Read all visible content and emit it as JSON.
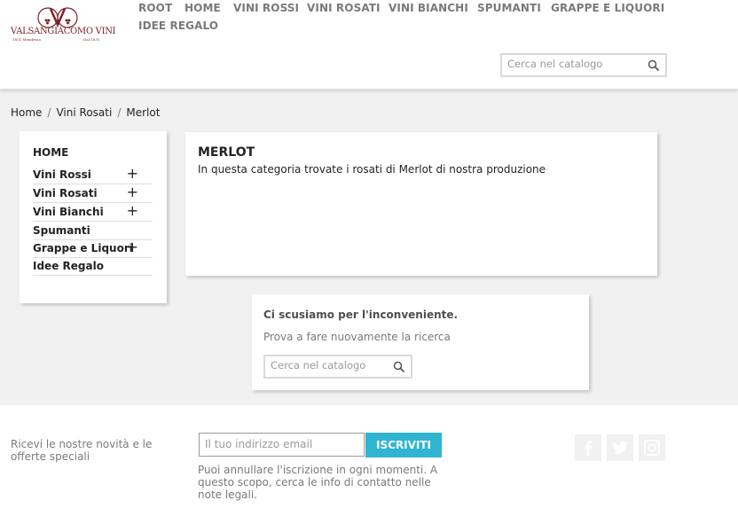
{
  "brand": {
    "name": "VALSANGIACOMO VINI",
    "tagline_left": "1831 Mendrisio",
    "tagline_right": "Dal 1831",
    "colors": {
      "primary": "#7a1f25",
      "accent": "#2fb5d2"
    }
  },
  "topnav": {
    "items": [
      {
        "label": "ROOT"
      },
      {
        "label": "HOME"
      },
      {
        "label": "VINI ROSSI"
      },
      {
        "label": "VINI ROSATI"
      },
      {
        "label": "VINI BIANCHI"
      },
      {
        "label": "SPUMANTI"
      },
      {
        "label": "GRAPPE E LIQUORI"
      },
      {
        "label": "IDEE REGALO"
      }
    ]
  },
  "header_search": {
    "placeholder": "Cerca nel catalogo",
    "icon": "search-icon"
  },
  "breadcrumb": {
    "items": [
      "Home",
      "Vini Rosati",
      "Merlot"
    ],
    "separator": "/"
  },
  "sidebar": {
    "home_label": "HOME",
    "expand_symbol": "+",
    "items": [
      {
        "label": "Vini Rossi",
        "expandable": true
      },
      {
        "label": "Vini Rosati",
        "expandable": true
      },
      {
        "label": "Vini Bianchi",
        "expandable": true
      },
      {
        "label": "Spumanti",
        "expandable": false
      },
      {
        "label": "Grappe e Liquori",
        "expandable": true
      },
      {
        "label": "Idee Regalo",
        "expandable": false
      }
    ]
  },
  "category": {
    "title": "MERLOT",
    "description": "In questa categoria trovate i rosati di Merlot di nostra produzione"
  },
  "no_results": {
    "heading": "Ci scusiamo per l'inconveniente.",
    "message": "Prova a fare nuovamente la ricerca",
    "search_placeholder": "Cerca nel catalogo"
  },
  "footer": {
    "newsletter_label": "Ricevi le nostre novità e le offerte speciali",
    "email_placeholder": "Il tuo indirizzo email",
    "subscribe_label": "ISCRIVITI",
    "note": "Puoi annullare l'iscrizione in ogni momenti. A questo scopo, cerca le info di contatto nelle note legali.",
    "social": [
      "facebook-icon",
      "twitter-icon",
      "instagram-icon"
    ]
  }
}
